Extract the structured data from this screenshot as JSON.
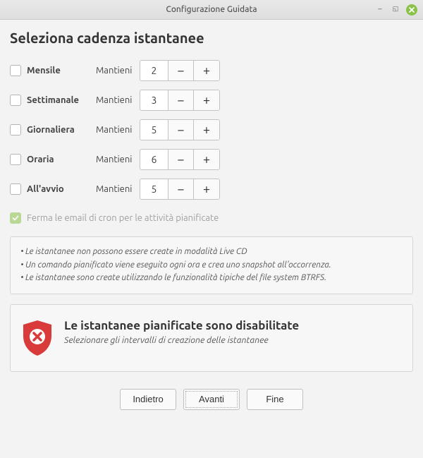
{
  "window": {
    "title": "Configurazione Guidata"
  },
  "heading": "Seleziona cadenza istantanee",
  "keep_label": "Mantieni",
  "schedules": [
    {
      "name": "Mensile",
      "checked": false,
      "value": 2
    },
    {
      "name": "Settimanale",
      "checked": false,
      "value": 3
    },
    {
      "name": "Giornaliera",
      "checked": false,
      "value": 5
    },
    {
      "name": "Oraria",
      "checked": false,
      "value": 6
    },
    {
      "name": "All'avvio",
      "checked": false,
      "value": 5
    }
  ],
  "stop_cron": {
    "label": "Ferma le email di cron per le attività pianificate",
    "checked": true,
    "enabled": false
  },
  "notes": [
    "Le istantanee non possono essere create in modalità Live CD",
    "Un comando pianificato viene eseguito ogni ora e crea uno snapshot all'occorrenza.",
    "Le istantanee sono create utilizzando le funzionalità tipiche del file system BTRFS."
  ],
  "warning": {
    "title": "Le istantanee pianificate sono disabilitate",
    "subtitle": "Selezionare gli intervalli di creazione delle istantanee",
    "icon": "shield-error-icon"
  },
  "footer": {
    "back": "Indietro",
    "next": "Avanti",
    "finish": "Fine"
  },
  "colors": {
    "accent_green": "#8bc34a",
    "danger_red": "#d93b3b"
  }
}
